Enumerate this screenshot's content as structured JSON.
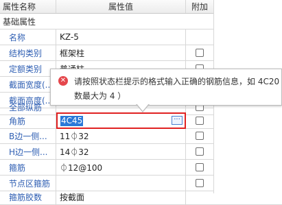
{
  "headers": {
    "name": "属性名称",
    "value": "属性值",
    "extra": "附加"
  },
  "group": {
    "label": "基础属性"
  },
  "rows": [
    {
      "name": "名称",
      "value": "KZ-5",
      "checkbox": false
    },
    {
      "name": "结构类别",
      "value": "框架柱",
      "checkbox": true
    },
    {
      "name": "定额类别",
      "value": "普通柱",
      "checkbox": true
    },
    {
      "name": "截面宽度(...",
      "value": "",
      "checkbox": true
    },
    {
      "name": "截面高度(...",
      "value": "",
      "checkbox": true
    },
    {
      "name": "全部纵筋",
      "value": "",
      "checkbox": true
    },
    {
      "name": "角筋",
      "value": "4C45",
      "checkbox": true
    },
    {
      "name": "B边一侧...",
      "value": "11⏀32",
      "checkbox": true
    },
    {
      "name": "H边一侧...",
      "value": "14⏀32",
      "checkbox": true
    },
    {
      "name": "箍筋",
      "value": "⏀12@100",
      "checkbox": true
    },
    {
      "name": "节点区箍筋",
      "value": "",
      "checkbox": true
    },
    {
      "name": "箍筋胶数",
      "value": "按截面",
      "checkbox": false
    }
  ],
  "editor": {
    "value": "4C45",
    "button_label": "···"
  },
  "tooltip": {
    "icon": "error-icon",
    "icon_glyph": "✕",
    "message": "请按照状态栏提示的格式输入正确的钢筋信息，如 4C20 数最大为 4 ）"
  },
  "colors": {
    "error": "#e02020",
    "selection": "#2b79d8",
    "link": "#2f5fb3"
  }
}
